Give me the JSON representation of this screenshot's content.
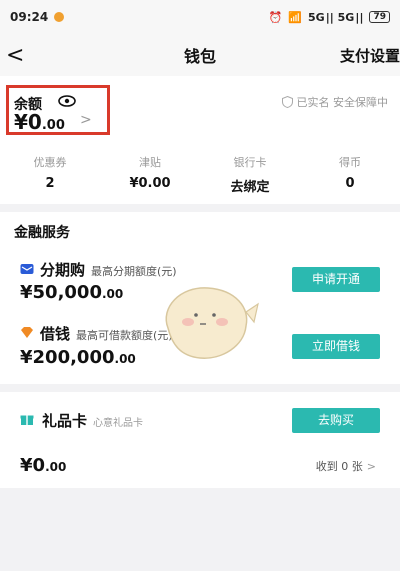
{
  "status_bar": {
    "time": "09:24",
    "signal": "5G || 5G ||",
    "battery": "79"
  },
  "nav": {
    "back": "<",
    "title": "钱包",
    "settings": "支付设置"
  },
  "balance": {
    "label": "余额",
    "value_main": "¥0",
    "value_decimal": ".00",
    "arrow": ">",
    "security_note": "已实名 安全保障中"
  },
  "assets": [
    {
      "label": "优惠券",
      "value": "2"
    },
    {
      "label": "津贴",
      "value": "¥0.00"
    },
    {
      "label": "银行卡",
      "value": "去绑定"
    },
    {
      "label": "得币",
      "value": "0"
    }
  ],
  "finance": {
    "title": "金融服务",
    "installment": {
      "name": "分期购",
      "sub": "最高分期额度(元)",
      "amount_main": "¥50,000",
      "amount_decimal": ".00",
      "button": "申请开通"
    },
    "loan": {
      "name": "借钱",
      "sub": "最高可借款额度(元)",
      "amount_main": "¥200,000",
      "amount_decimal": ".00",
      "button": "立即借钱"
    }
  },
  "gift": {
    "name": "礼品卡",
    "sub": "心意礼品卡",
    "button": "去购买",
    "amount_main": "¥0",
    "amount_decimal": ".00",
    "received": "收到 0 张",
    "chevron": ">"
  },
  "colors": {
    "accent": "#2bb9b0",
    "highlight_border": "#d93a2b",
    "installment_icon": "#2a5bd7",
    "loan_icon": "#f08a24"
  }
}
